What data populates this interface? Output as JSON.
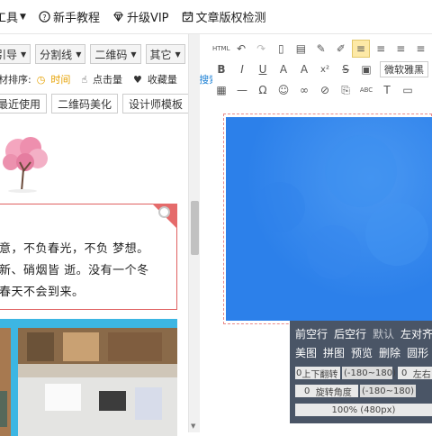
{
  "topbar": {
    "tools_label": "工具",
    "tutorial_label": "新手教程",
    "vip_label": "升级VIP",
    "copyright_label": "文章版权检测"
  },
  "filters": {
    "guide": "引导",
    "divider": "分割线",
    "qrcode": "二维码",
    "other": "其它"
  },
  "sort": {
    "prefix": "材排序:",
    "time": "时间",
    "clicks": "点击量",
    "favorites": "收藏量",
    "search": "搜索"
  },
  "tags": [
    "最近使用",
    "二维码美化",
    "设计师模板"
  ],
  "card": {
    "line1": "意，不负春光，不负 梦想。",
    "line2": "新、硝烟皆 逝。没有一个冬",
    "line3": "春天不会到来。"
  },
  "editor": {
    "font_select": "微软雅黑"
  },
  "panel": {
    "row1": [
      "前空行",
      "后空行",
      "默认",
      "左对齐",
      "居"
    ],
    "row2": [
      "美图",
      "拼图",
      "预览",
      "删除",
      "圆形",
      "正"
    ],
    "flip_label": "上下翻转",
    "flip_value": "0",
    "flip_range": "(-180~180)",
    "lr_value": "0",
    "lr_label": "左右",
    "rotate_value": "0",
    "rotate_label": "旋转角度",
    "rotate_range": "(-180~180)",
    "zoom": "100% (480px)"
  }
}
